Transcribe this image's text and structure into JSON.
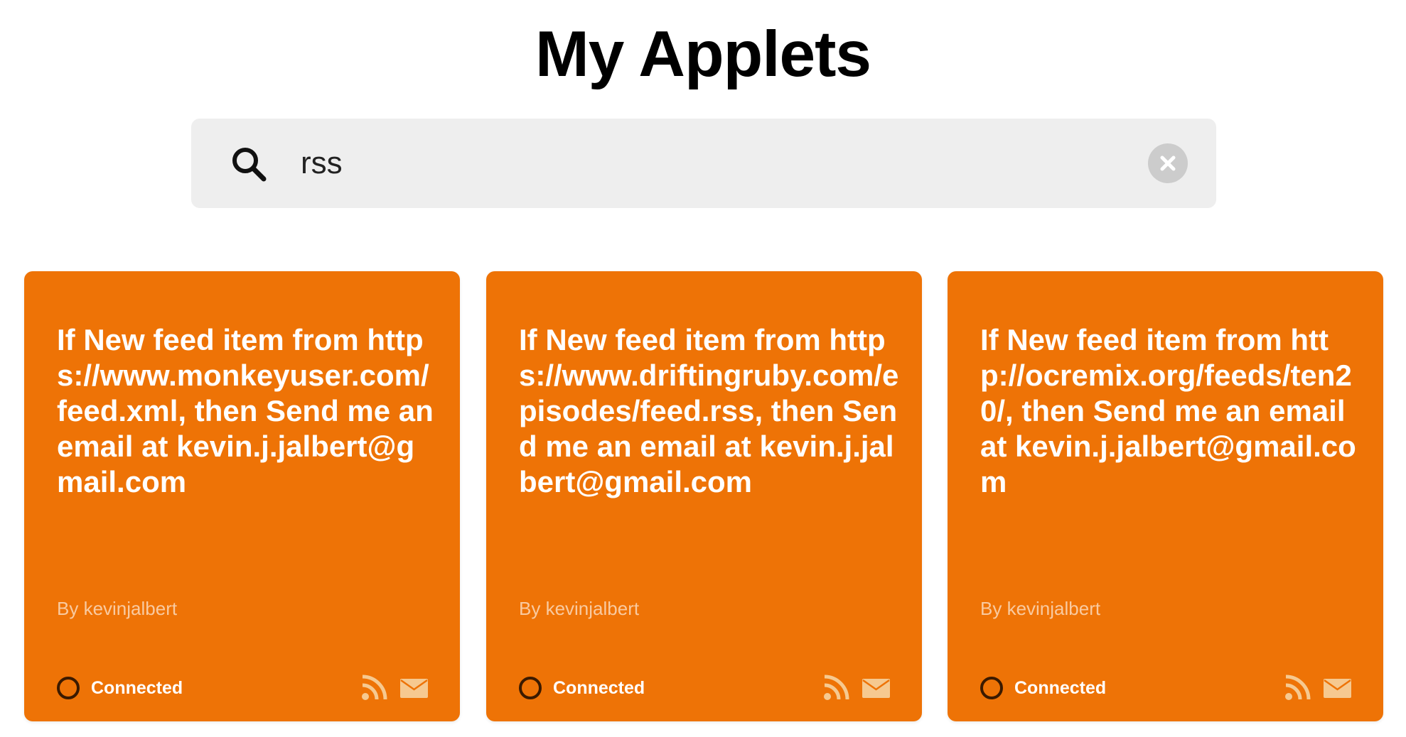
{
  "page": {
    "title": "My Applets"
  },
  "search": {
    "value": "rss",
    "icon": "search-icon",
    "clear_icon": "close-icon"
  },
  "colors": {
    "card_background": "#ee7306",
    "search_background": "#eeeeee",
    "card_text": "#ffffff"
  },
  "applets": [
    {
      "text": "If New feed item from https://www.monkeyuser.com/feed.xml, then Send me an email at kevin.j.jalbert@gmail.com",
      "author": "By kevinjalbert",
      "status": "Connected",
      "icons": [
        "rss-icon",
        "mail-icon"
      ]
    },
    {
      "text": "If New feed item from https://www.driftingruby.com/episodes/feed.rss, then Send me an email at kevin.j.jalbert@gmail.com",
      "author": "By kevinjalbert",
      "status": "Connected",
      "icons": [
        "rss-icon",
        "mail-icon"
      ]
    },
    {
      "text": "If New feed item from http://ocremix.org/feeds/ten20/, then Send me an email at kevin.j.jalbert@gmail.com",
      "author": "By kevinjalbert",
      "status": "Connected",
      "icons": [
        "rss-icon",
        "mail-icon"
      ]
    }
  ]
}
